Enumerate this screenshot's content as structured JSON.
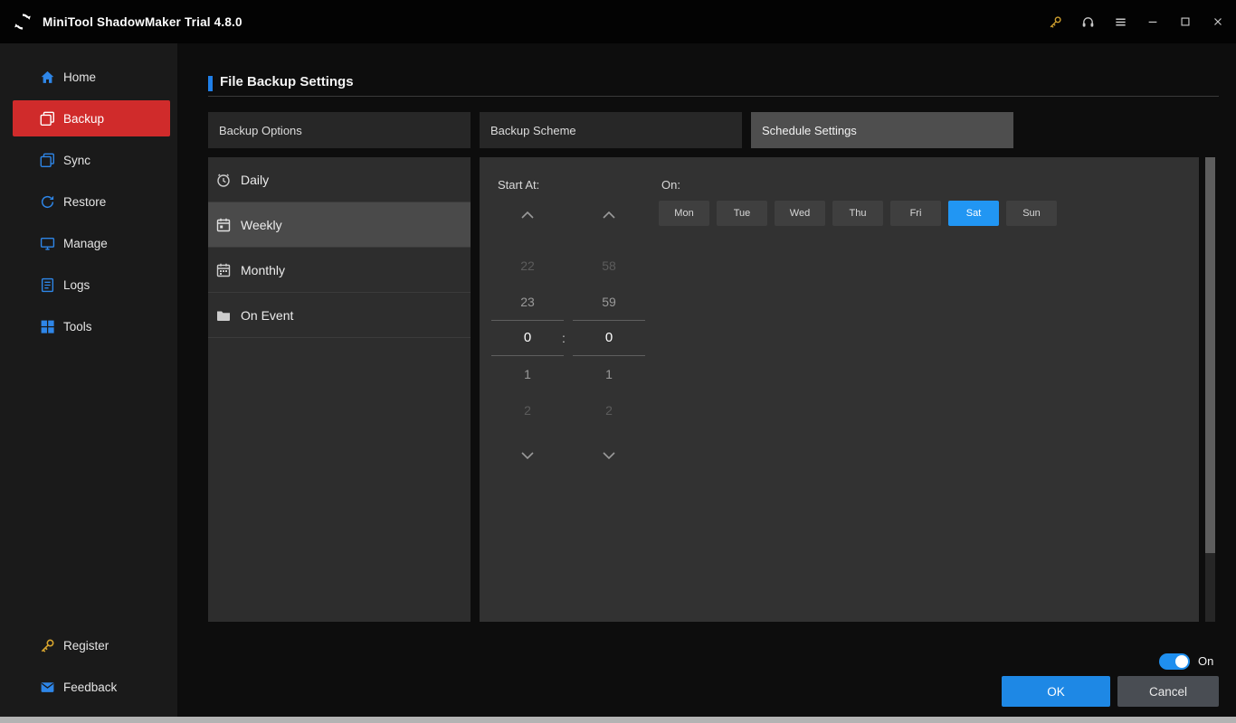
{
  "titlebar": {
    "title": "MiniTool ShadowMaker Trial 4.8.0"
  },
  "sidebar": {
    "items": [
      {
        "label": "Home",
        "icon": "home-icon",
        "active": false
      },
      {
        "label": "Backup",
        "icon": "backup-icon",
        "active": true
      },
      {
        "label": "Sync",
        "icon": "sync-icon",
        "active": false
      },
      {
        "label": "Restore",
        "icon": "restore-icon",
        "active": false
      },
      {
        "label": "Manage",
        "icon": "manage-icon",
        "active": false
      },
      {
        "label": "Logs",
        "icon": "logs-icon",
        "active": false
      },
      {
        "label": "Tools",
        "icon": "tools-icon",
        "active": false
      }
    ],
    "footer_items": [
      {
        "label": "Register",
        "icon": "key-icon"
      },
      {
        "label": "Feedback",
        "icon": "mail-icon"
      }
    ]
  },
  "page": {
    "title": "File Backup Settings"
  },
  "tabs": [
    {
      "label": "Backup Options",
      "active": false
    },
    {
      "label": "Backup Scheme",
      "active": false
    },
    {
      "label": "Schedule Settings",
      "active": true
    }
  ],
  "schedule": {
    "modes": [
      {
        "label": "Daily",
        "icon": "alarm-clock-icon",
        "active": false
      },
      {
        "label": "Weekly",
        "icon": "weekly-calendar-icon",
        "active": true
      },
      {
        "label": "Monthly",
        "icon": "monthly-calendar-icon",
        "active": false
      },
      {
        "label": "On Event",
        "icon": "folder-icon",
        "active": false
      }
    ],
    "start_at_label": "Start At:",
    "hour_values": [
      "22",
      "23",
      "0",
      "1",
      "2"
    ],
    "minute_values": [
      "58",
      "59",
      "0",
      "1",
      "2"
    ],
    "selected_hour": "0",
    "selected_minute": "0",
    "time_separator": ":",
    "on_label": "On:",
    "days": [
      {
        "label": "Mon",
        "selected": false
      },
      {
        "label": "Tue",
        "selected": false
      },
      {
        "label": "Wed",
        "selected": false
      },
      {
        "label": "Thu",
        "selected": false
      },
      {
        "label": "Fri",
        "selected": false
      },
      {
        "label": "Sat",
        "selected": true
      },
      {
        "label": "Sun",
        "selected": false
      }
    ]
  },
  "footer": {
    "schedule_toggle_state": "On",
    "ok_label": "OK",
    "cancel_label": "Cancel"
  },
  "colors": {
    "accent_blue": "#2196f3",
    "active_red": "#d02b2b"
  }
}
